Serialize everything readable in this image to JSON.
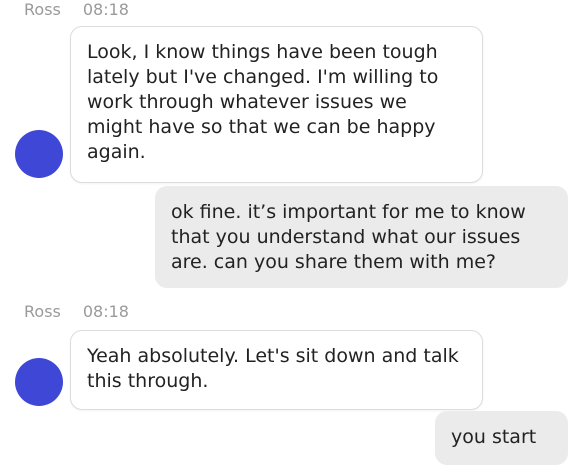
{
  "chat": {
    "messages": [
      {
        "direction": "incoming",
        "sender": "Ross",
        "time": "08:18",
        "text": "Look, I know things have been tough lately but I've changed. I'm willing to work through whatever issues we might have so that we can be happy again."
      },
      {
        "direction": "outgoing",
        "text": "ok fine. it’s important for me to know that you understand what our issues are. can you share them with me?"
      },
      {
        "direction": "incoming",
        "sender": "Ross",
        "time": "08:18",
        "text": "Yeah absolutely. Let's sit down and talk this through."
      },
      {
        "direction": "outgoing",
        "text": "you start"
      }
    ]
  },
  "colors": {
    "avatar": "#3f47d6",
    "incoming_bubble": "#ffffff",
    "outgoing_bubble": "#ebebeb",
    "meta_text": "#9a9a9a"
  }
}
